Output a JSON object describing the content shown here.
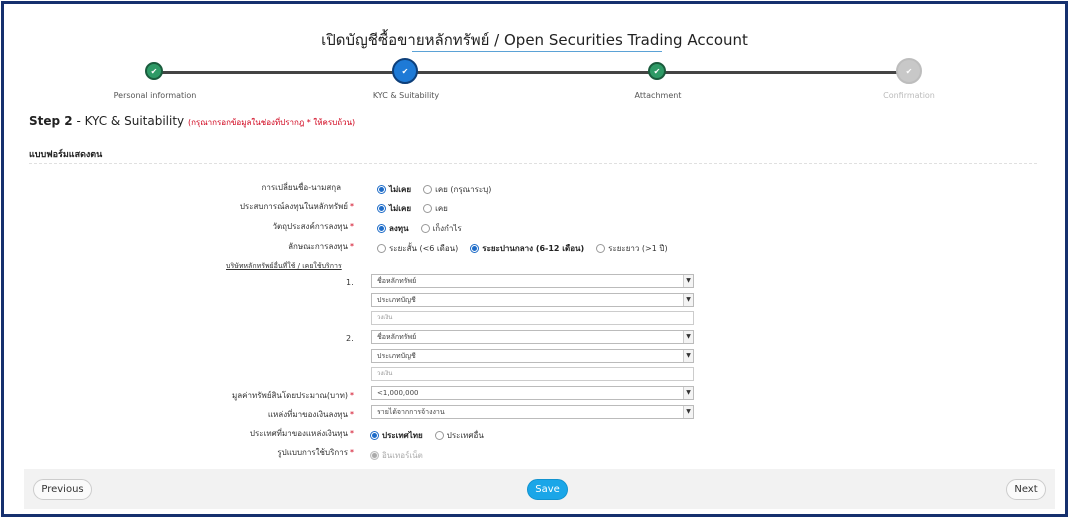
{
  "header": {
    "title": "เปิดบัญชีซื้อขายหลักทรัพย์ / Open Securities Trading Account"
  },
  "steps": [
    {
      "label": "Personal information",
      "state": "done",
      "icon": "check-icon"
    },
    {
      "label": "KYC & Suitability",
      "state": "active",
      "icon": "check-icon"
    },
    {
      "label": "Attachment",
      "state": "done",
      "icon": "check-icon"
    },
    {
      "label": "Confirmation",
      "state": "todo",
      "icon": "check-icon"
    }
  ],
  "step_heading": {
    "prefix": "Step 2",
    "sep": " - ",
    "name": "KYC & Suitability",
    "note": "(กรุณากรอกข้อมูลในช่องที่ปรากฎ * ให้ครบถ้วน)"
  },
  "section": {
    "title": "แบบฟอร์มแสดงตน"
  },
  "form": {
    "name_change": {
      "label": "การเปลี่ยนชื่อ-นามสกุล",
      "options": [
        "ไม่เคย",
        "เคย (กรุณาระบุ)"
      ],
      "selected": 0
    },
    "invest_experience": {
      "label": "ประสบการณ์ลงทุนในหลักทรัพย์",
      "required": "*",
      "options": [
        "ไม่เคย",
        "เคย"
      ],
      "selected": 0
    },
    "objective": {
      "label": "วัตถุประสงค์การลงทุน",
      "required": "*",
      "options": [
        "ลงทุน",
        "เก็งกำไร"
      ],
      "selected": 0
    },
    "invest_type": {
      "label": "ลักษณะการลงทุน",
      "required": "*",
      "options": [
        "ระยะสั้น (<6 เดือน)",
        "ระยะปานกลาง (6-12 เดือน)",
        "ระยะยาว (>1 ปี)"
      ],
      "selected": 1
    },
    "other_brokers_link": "บริษัทหลักทรัพย์อื่นที่ใช้ / เคยใช้บริการ",
    "brokers": [
      {
        "num": "1.",
        "broker": "ชื่อหลักทรัพย์",
        "account_type": "ประเภทบัญชี",
        "credit_placeholder": "วงเงิน"
      },
      {
        "num": "2.",
        "broker": "ชื่อหลักทรัพย์",
        "account_type": "ประเภทบัญชี",
        "credit_placeholder": "วงเงิน"
      }
    ],
    "total_assets": {
      "label": "มูลค่าทรัพย์สินโดยประมาณ(บาท)",
      "required": "*",
      "value": "<1,000,000"
    },
    "income_source": {
      "label": "แหล่งที่มาของเงินลงทุน",
      "required": "*",
      "value": "รายได้จากการจ้างงาน"
    },
    "income_country": {
      "label": "ประเทศที่มาของแหล่งเงินทุน",
      "required": "*",
      "options": [
        "ประเทศไทย",
        "ประเทศอื่น"
      ],
      "selected": 0
    },
    "service_type": {
      "label": "รูปแบบการใช้บริการ",
      "required": "*",
      "options": [
        "อินเทอร์เน็ต"
      ],
      "selected": 0
    }
  },
  "footer": {
    "previous": "Previous",
    "save": "Save",
    "next": "Next"
  },
  "colors": {
    "frame": "#16306e",
    "done": "#2e9a66",
    "active": "#1e7ad6",
    "primary_button": "#1aa6e8",
    "required": "#d0021b"
  }
}
